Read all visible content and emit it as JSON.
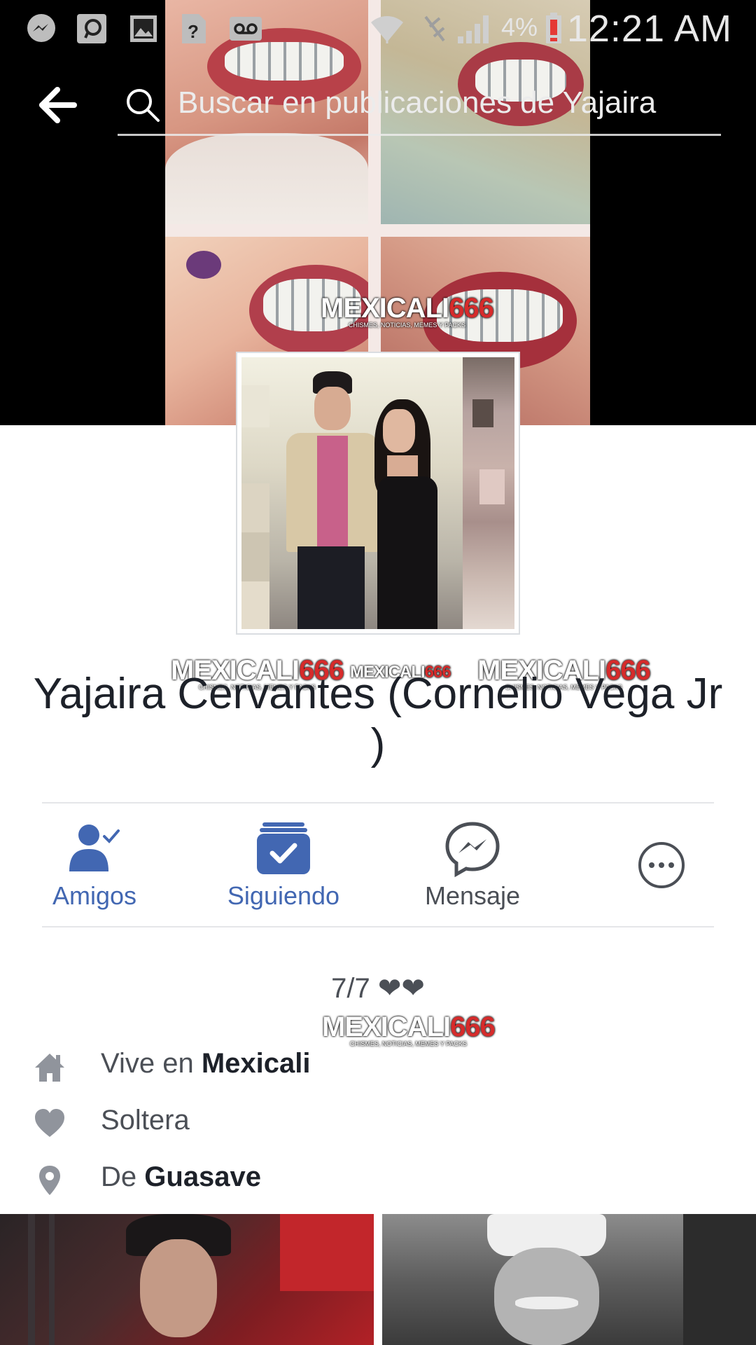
{
  "status_bar": {
    "battery_percent": "4%",
    "time": "12:21 AM",
    "icons": [
      "messenger-icon",
      "chat-bubble-icon",
      "gallery-icon",
      "unknown-app-icon",
      "voicemail-icon",
      "wifi-icon",
      "no-signal-icon",
      "signal-bars-icon",
      "battery-low-icon"
    ]
  },
  "search": {
    "placeholder": "Buscar en publicaciones de Yajaira"
  },
  "watermark": {
    "brand": "MEXICALI",
    "number": "666",
    "tagline": "CHISMES, NOTICIAS, MEMES Y PACKS"
  },
  "profile": {
    "name": "Yajaira Cervantes (Cornelio Vega Jr )"
  },
  "actions": [
    {
      "label": "Amigos",
      "icon": "friends-check-icon",
      "color": "#4267b2"
    },
    {
      "label": "Siguiendo",
      "icon": "following-check-icon",
      "color": "#4267b2"
    },
    {
      "label": "Mensaje",
      "icon": "messenger-icon",
      "color": "#4b4f56"
    },
    {
      "label": "",
      "icon": "more-options-icon",
      "color": "#4b4f56"
    }
  ],
  "intro": {
    "bio": "7/7 ❤❤",
    "lives_prefix": "Vive en",
    "lives_value": "Mexicali",
    "relationship": "Soltera",
    "from_prefix": "De",
    "from_value": "Guasave"
  },
  "colors": {
    "accent": "#4267b2",
    "text_dark": "#1d2129",
    "text_muted": "#4b4f56",
    "icon_gray": "#90949c"
  }
}
